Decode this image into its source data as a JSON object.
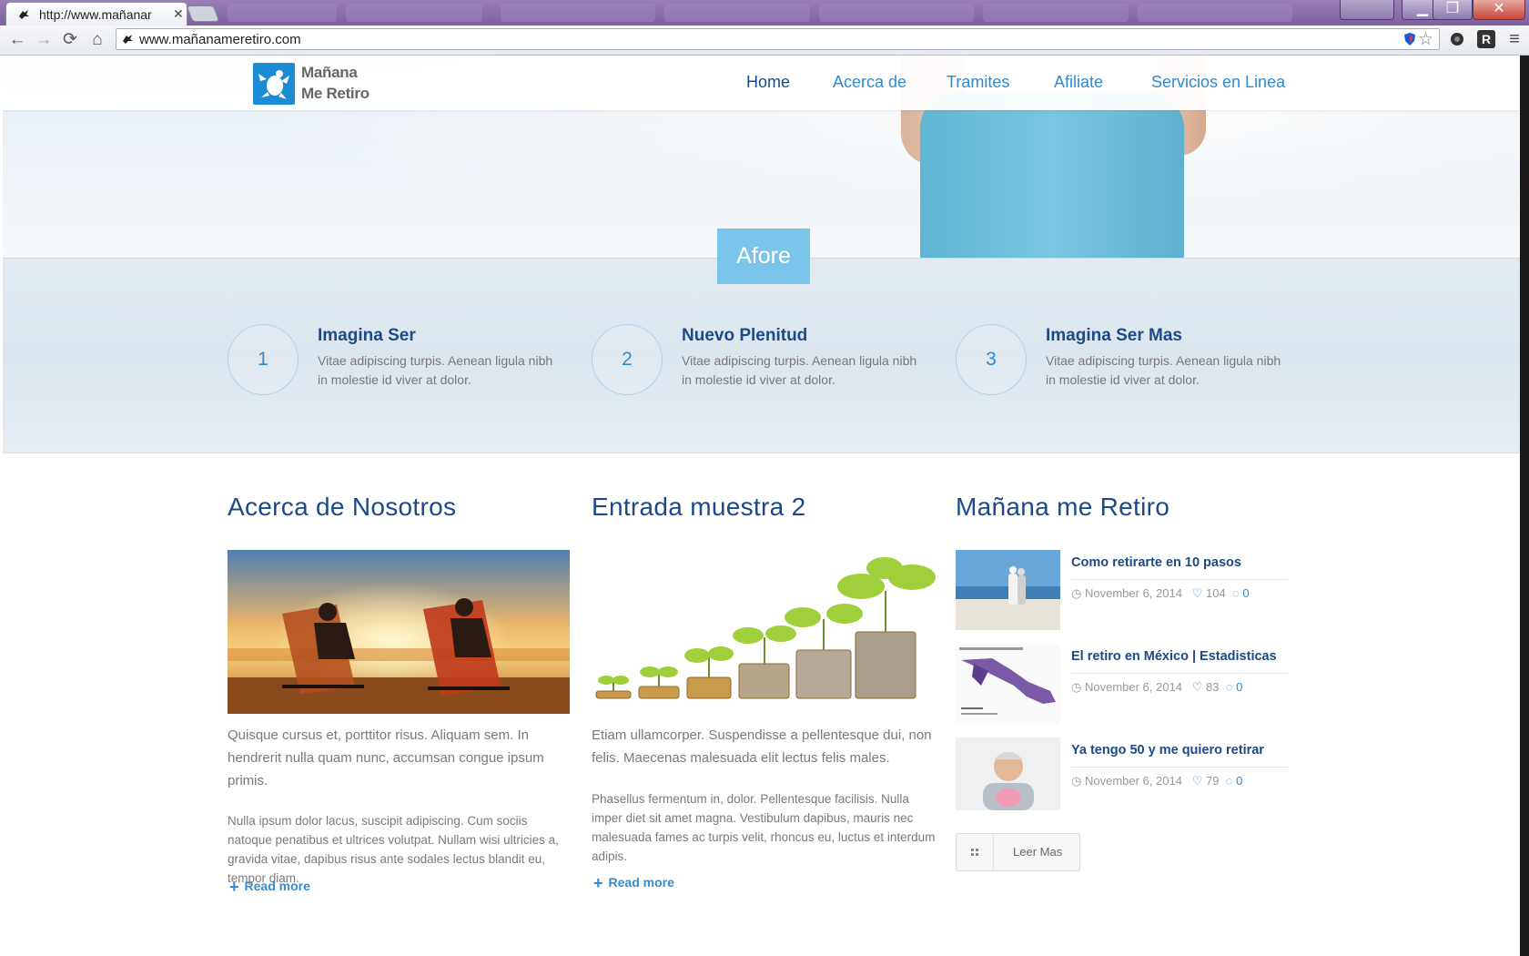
{
  "browser": {
    "tab_title": "http://www.mañanar",
    "tab_close": "✕",
    "url": "www.mañanameretiro.com",
    "nav": {
      "back": "←",
      "forward": "→",
      "reload": "⟳",
      "home": "⌂"
    },
    "window_controls": {
      "minimize": "▁",
      "maximize": "❐",
      "close": "✕"
    },
    "extensions": {
      "star": "☆",
      "ext_r": "R",
      "menu": "≡"
    }
  },
  "site": {
    "logo": {
      "line1": "Mañana",
      "line2": "Me Retiro"
    },
    "nav": [
      {
        "label": "Home"
      },
      {
        "label": "Acerca de"
      },
      {
        "label": "Tramites"
      },
      {
        "label": "Afiliate"
      },
      {
        "label": "Servicios en Linea"
      }
    ],
    "hero_tab": "Afore",
    "features": [
      {
        "number": "1",
        "title": "Imagina Ser",
        "text": "Vitae adipiscing turpis. Aenean ligula nibh in molestie id viver at dolor."
      },
      {
        "number": "2",
        "title": "Nuevo Plenitud",
        "text": "Vitae adipiscing turpis. Aenean ligula nibh in molestie id viver at dolor."
      },
      {
        "number": "3",
        "title": "Imagina Ser Mas",
        "text": "Vitae adipiscing turpis. Aenean ligula nibh in molestie id viver at dolor."
      }
    ],
    "columns": {
      "about": {
        "title": "Acerca de Nosotros",
        "p1": "Quisque cursus et, porttitor risus. Aliquam sem. In hendrerit nulla quam nunc, accumsan congue ipsum primis.",
        "p2": "Nulla ipsum dolor lacus, suscipit adipiscing. Cum sociis natoque penatibus et ultrices volutpat. Nullam wisi ultricies a, gravida vitae, dapibus risus ante sodales lectus blandit eu, tempor diam.",
        "read_more": "Read more"
      },
      "entry": {
        "title": "Entrada muestra 2",
        "p1": "Etiam ullamcorper. Suspendisse a pellentesque dui, non felis. Maecenas malesuada elit lectus felis males.",
        "p2": "Phasellus fermentum in, dolor. Pellentesque facilisis. Nulla imper diet sit amet magna. Vestibulum dapibus, mauris nec malesuada fames ac turpis velit, rhoncus eu, luctus et interdum adipis.",
        "read_more": "Read more"
      },
      "blog": {
        "title": "Mañana me Retiro",
        "posts": [
          {
            "title": "Como retirarte en 10 pasos",
            "date": "November 6, 2014",
            "likes": "104",
            "comments": "0"
          },
          {
            "title": "El retiro en México | Estadisticas",
            "date": "November 6, 2014",
            "likes": "83",
            "comments": "0"
          },
          {
            "title": "Ya tengo 50 y me quiero retirar",
            "date": "November 6, 2014",
            "likes": "79",
            "comments": "0"
          }
        ],
        "more_button": "Leer Mas"
      }
    }
  },
  "colors": {
    "brand_blue": "#1b8bd2",
    "link_blue": "#2f8bd2",
    "heading_navy": "#1d4a86",
    "tab_blue": "#7bc4ea"
  }
}
